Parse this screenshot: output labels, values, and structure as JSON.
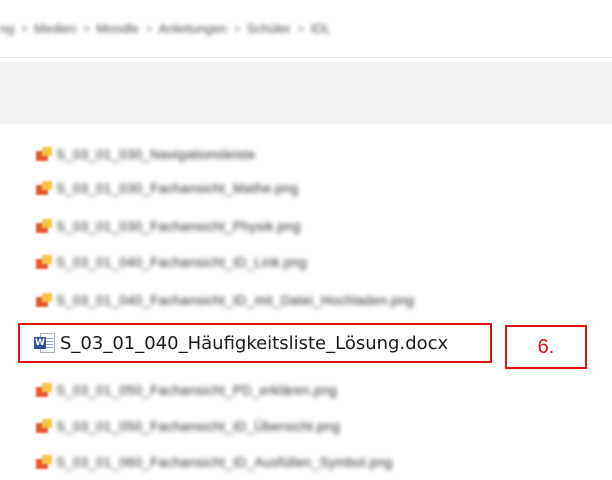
{
  "breadcrumb": {
    "items": [
      "ng",
      "Medien",
      "Moodle",
      "Anleitungen",
      "Schüler",
      "IDL"
    ],
    "separator": ">"
  },
  "files": [
    {
      "name": "S_03_01_030_Navigationsleiste",
      "icon": "image-file-icon"
    },
    {
      "name": "S_03_01_030_Fachansicht_Mathe.png",
      "icon": "image-file-icon"
    },
    {
      "name": "S_03_01_030_Fachansicht_Physik.png",
      "icon": "image-file-icon"
    },
    {
      "name": "S_03_01_040_Fachansicht_ID_Link.png",
      "icon": "image-file-icon"
    },
    {
      "name": "S_03_01_040_Fachansicht_ID_mit_Datei_Hochladen.png",
      "icon": "image-file-icon"
    },
    {
      "name": "S_03_01_040_Häufigkeitsliste_Lösung.docx",
      "icon": "word-doc-icon",
      "selected": true
    },
    {
      "name": "S_03_01_050_Fachansicht_PD_erklären.png",
      "icon": "image-file-icon"
    },
    {
      "name": "S_03_01_050_Fachansicht_ID_Übersicht.png",
      "icon": "image-file-icon"
    },
    {
      "name": "S_03_01_060_Fachansicht_ID_Ausfüllen_Symbol.png",
      "icon": "image-file-icon"
    }
  ],
  "step_badge": "6.",
  "colors": {
    "highlight": "#e01313",
    "word_blue": "#2b579a"
  }
}
